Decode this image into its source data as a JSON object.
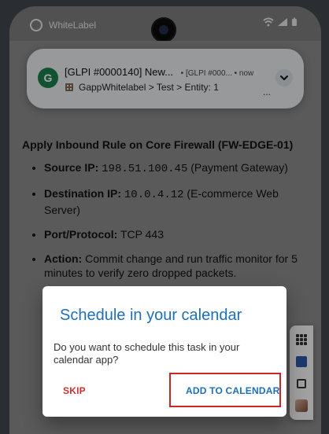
{
  "statusbar": {
    "app_name": "WhiteLabel",
    "icons": [
      "wifi-icon",
      "signal-icon",
      "battery-icon"
    ]
  },
  "notification": {
    "app_icon": "G",
    "title": "[GLPI #0000140] New...",
    "meta": "• [GLPI #000... • now",
    "subtitle": "GappWhitelabel > Test > Entity: 1",
    "ellipsis": "..."
  },
  "task": {
    "heading": "Apply Inbound Rule on Core Firewall (FW-EDGE-01)",
    "bullets": [
      {
        "label": "Source IP:",
        "value": "198.51.100.45",
        "tail": "(Payment Gateway)"
      },
      {
        "label": "Destination IP:",
        "value": "10.0.4.12",
        "tail": "(E-commerce Web Server)"
      },
      {
        "label": "Port/Protocol:",
        "text": "TCP 443"
      },
      {
        "label": "Action:",
        "text": "Commit change and run traffic monitor for 5 minutes to verify zero dropped packets."
      }
    ]
  },
  "dialog": {
    "title": "Schedule in your calendar",
    "message": "Do you want to schedule this task in your calendar app?",
    "skip_label": "SKIP",
    "add_label": "ADD TO CALENDAR"
  },
  "colors": {
    "accent": "#1e6fb7",
    "danger": "#d3302f",
    "highlight": "#c62828"
  }
}
